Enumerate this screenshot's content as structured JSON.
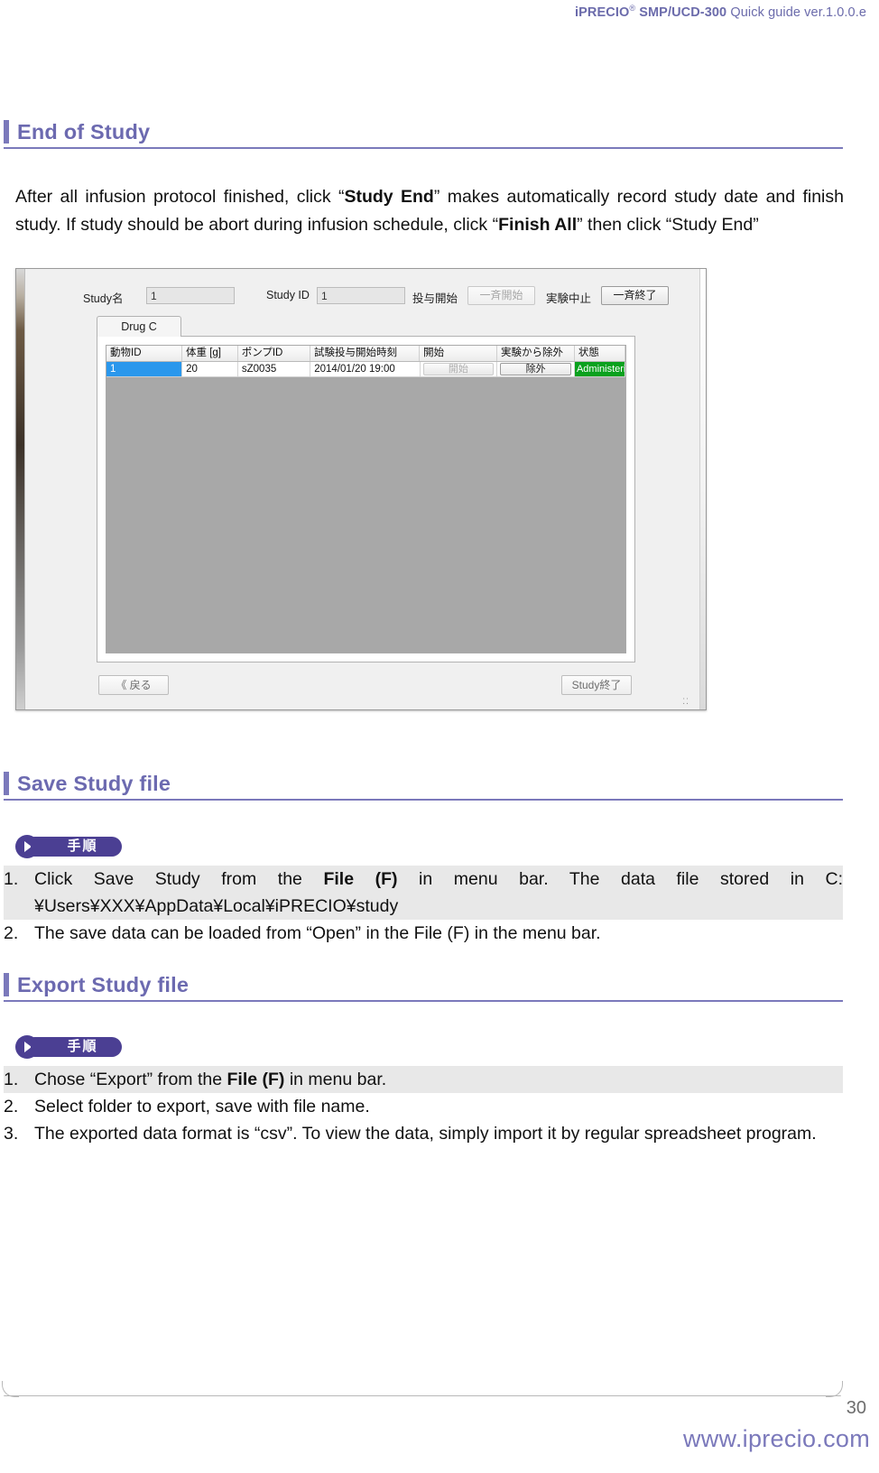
{
  "header": {
    "brand": "iPRECIO",
    "registered": "®",
    "model": "SMP/UCD-300",
    "doc": "Quick  guide  ver.1.0.0.e"
  },
  "sections": {
    "end_of_study": {
      "title": "End of Study",
      "paragraph_parts": [
        {
          "t": "After  all  infusion  protocol  finished,  click  “",
          "b": false
        },
        {
          "t": "Study  End",
          "b": true
        },
        {
          "t": "”  makes  automatically  record  study date and finish study. If study should be abort during infusion schedule, click “",
          "b": false
        },
        {
          "t": "Finish All",
          "b": true
        },
        {
          "t": "” then click “Study End”",
          "b": false
        }
      ]
    },
    "save_study_file": {
      "title": "Save Study file",
      "badge": "手順",
      "items": [
        {
          "num": "1.",
          "highlight": true,
          "parts": [
            {
              "t": "Click  Save  Study  from  the  ",
              "b": false
            },
            {
              "t": "File  (F)",
              "b": true
            },
            {
              "t": "  in  menu  bar.  The  data  file  stored  in C:¥Users¥XXX¥AppData¥Local¥iPRECIO¥study",
              "b": false
            }
          ]
        },
        {
          "num": "2.",
          "highlight": false,
          "parts": [
            {
              "t": "The save data can be loaded from “Open” in the File (F) in the menu bar.",
              "b": false
            }
          ]
        }
      ]
    },
    "export_study_file": {
      "title": "Export Study file",
      "badge": "手順",
      "items": [
        {
          "num": "1.",
          "highlight": true,
          "parts": [
            {
              "t": "Chose “Export” from the ",
              "b": false
            },
            {
              "t": "File (F)",
              "b": true
            },
            {
              "t": " in menu bar.",
              "b": false
            }
          ]
        },
        {
          "num": "2.",
          "highlight": false,
          "parts": [
            {
              "t": "Select folder to export, save with file name.",
              "b": false
            }
          ]
        },
        {
          "num": "3.",
          "highlight": false,
          "parts": [
            {
              "t": "The  exported  data  format  is  “csv”.   To  view  the  data,  simply  import  it  by  regular spreadsheet program.",
              "b": false
            }
          ]
        }
      ]
    }
  },
  "app_window": {
    "toolbar": {
      "study_name_label": "Study名",
      "study_name_value": "1",
      "study_id_label": "Study ID",
      "study_id_value": "1",
      "start_dosing_label": "投与開始",
      "start_all_button": "一斉開始",
      "abort_label": "実験中止",
      "finish_all_button": "一斉終了"
    },
    "tab": "Drug C",
    "grid": {
      "columns": [
        "動物ID",
        "体重 [g]",
        "ポンプID",
        "試験投与開始時刻",
        "開始",
        "実験から除外",
        "状態"
      ],
      "rows": [
        {
          "animal_id": "1",
          "weight": "20",
          "pump_id": "sZ0035",
          "start_time": "2014/01/20 19:00",
          "start_button": "開始",
          "exclude_button": "除外",
          "status": "Administering"
        }
      ]
    },
    "back_button": "《 戻る",
    "study_end_button": "Study終了",
    "resize_grip": "⁚⁚"
  },
  "footer": {
    "page_number": "30",
    "url": "www.iprecio.com"
  }
}
